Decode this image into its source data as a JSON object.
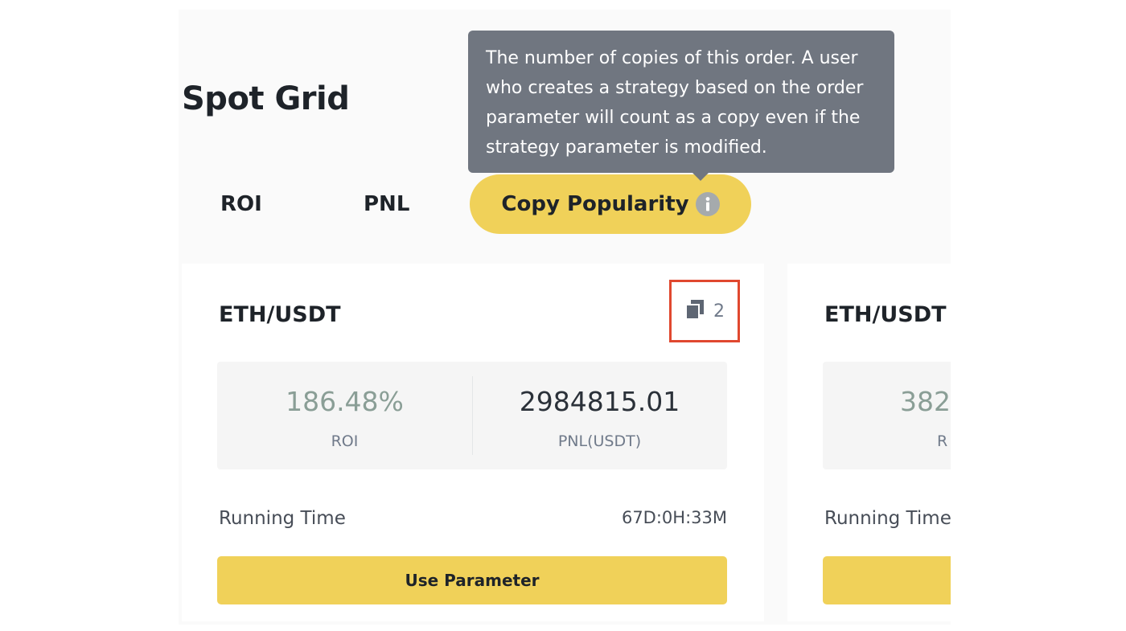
{
  "page_title": "Spot Grid",
  "tabs": [
    {
      "label": "ROI"
    },
    {
      "label": "PNL"
    },
    {
      "label": "Copy Popularity"
    }
  ],
  "tooltip": {
    "lines": [
      "The number of copies of this order. A user",
      "who creates a strategy based on the order",
      "parameter will count as a copy even if the",
      "strategy parameter is modified."
    ]
  },
  "cards": [
    {
      "pair": "ETH/USDT",
      "copies": "2",
      "roi_value": "186.48%",
      "roi_label": "ROI",
      "pnl_value": "2984815.01",
      "pnl_label": "PNL(USDT)",
      "running_time_label": "Running Time",
      "running_time_value": "67D:0H:33M",
      "button_label": "Use Parameter"
    },
    {
      "pair": "ETH/USDT",
      "roi_value": "382",
      "roi_label": "R",
      "running_time_label": "Running Time"
    }
  ],
  "colors": {
    "accent_yellow": "#f0d159",
    "tooltip_bg": "#707680",
    "roi_value_color": "#8a9e96",
    "highlight_box": "#e0482f"
  },
  "icons": {
    "info": "info-icon",
    "copies": "copies-icon"
  }
}
